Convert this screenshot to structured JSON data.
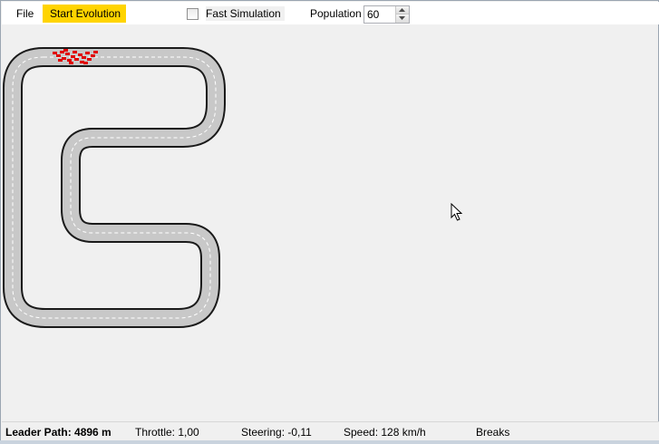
{
  "menu": {
    "file_label": "File",
    "start_label": "Start Evolution"
  },
  "toolbar": {
    "fast_simulation_label": "Fast Simulation",
    "fast_simulation_checked": false,
    "population_label": "Population",
    "population_value": "60"
  },
  "colors": {
    "start_highlight": "#ffd400",
    "track_fill": "#c8c8c8",
    "track_border": "#1a1a1a",
    "lane_marking": "#ffffff",
    "cars": "#e00000"
  },
  "status": {
    "leader_path": "Leader Path: 4896 m",
    "throttle": "Throttle: 1,00",
    "steering": "Steering: -0,11",
    "speed": "Speed: 128 km/h",
    "breaks": "Breaks"
  },
  "icons": {
    "spin_up": "chevron-up-icon",
    "spin_down": "chevron-down-icon",
    "cursor": "mouse-pointer-icon"
  }
}
